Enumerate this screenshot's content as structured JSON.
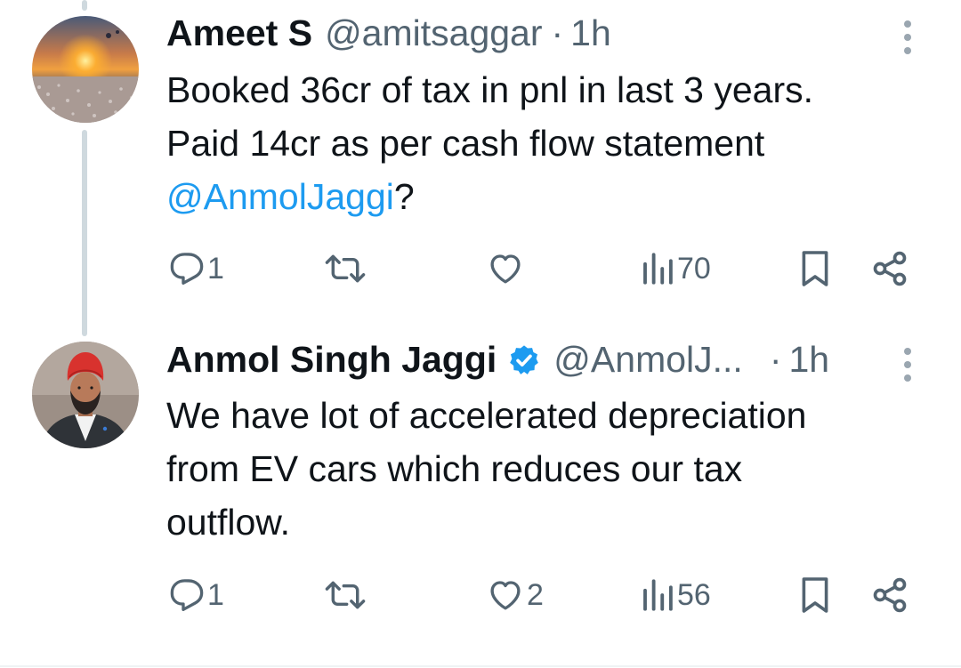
{
  "tweets": [
    {
      "name": "Ameet S",
      "handle": "@amitsaggar",
      "separator": "·",
      "time": "1h",
      "verified": false,
      "lines": [
        "Booked 36cr of tax in pnl in last 3 years.",
        "Paid 14cr as per cash flow statement"
      ],
      "mention": "@AnmolJaggi",
      "mention_suffix": "?",
      "replies": "1",
      "retweets": "",
      "likes": "",
      "views": "70"
    },
    {
      "name": "Anmol Singh Jaggi",
      "handle": "@AnmolJ...",
      "separator": "·",
      "time": "1h",
      "verified": true,
      "lines": [
        "We have lot of accelerated depreciation",
        "from EV cars which reduces our tax",
        "outflow."
      ],
      "replies": "1",
      "retweets": "",
      "likes": "2",
      "views": "56"
    }
  ],
  "icons": {
    "reply": "reply-icon",
    "retweet": "retweet-icon",
    "like": "heart-icon",
    "views": "views-icon",
    "bookmark": "bookmark-icon",
    "share": "share-icon",
    "more": "more-vertical-icon",
    "verified": "verified-badge-icon"
  },
  "colors": {
    "text": "#0f1419",
    "secondary": "#536471",
    "accent": "#1d9bf0",
    "thread_line": "#cfd9de"
  }
}
